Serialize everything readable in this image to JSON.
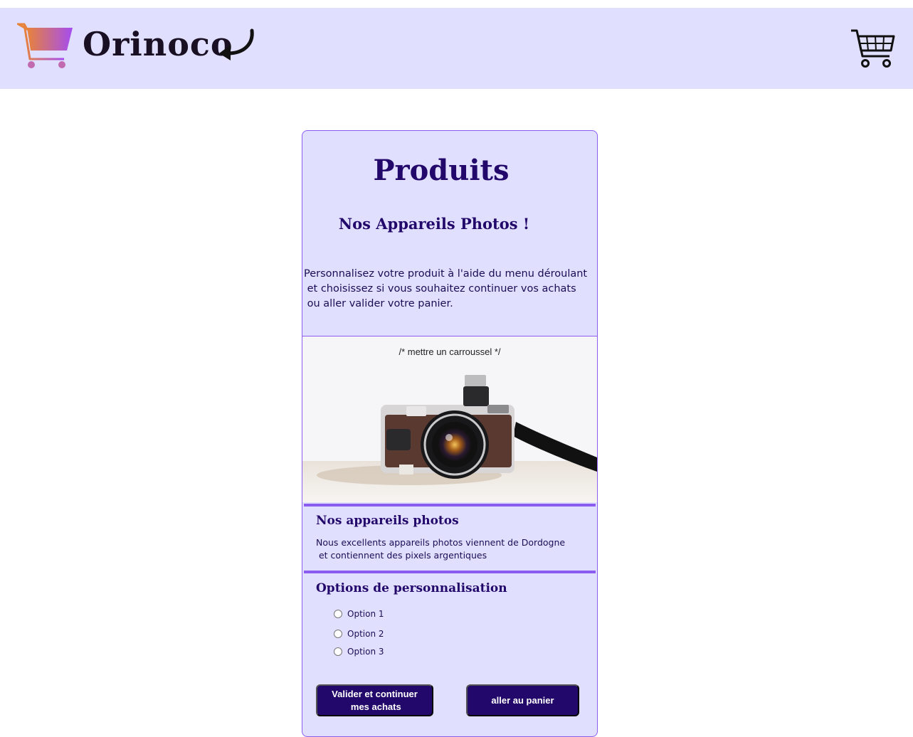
{
  "header": {
    "brand": "Orinoco",
    "logo_icon": "shopping-cart-gradient-icon",
    "back_icon": "curved-back-arrow-icon",
    "cart_icon": "shopping-cart-icon"
  },
  "card": {
    "title": "Produits",
    "subtitle": "Nos Appareils Photos !",
    "intro_lines": [
      "Personnalisez votre produit à l'aide du menu déroulant",
      " et choisissez si vous souhaitez continuer vos achats",
      " ou aller valider votre panier."
    ],
    "carousel_note": "/* mettre un carroussel */",
    "product": {
      "heading": "Nos appareils photos",
      "description_lines": [
        "Nous excellents appareils photos viennent de Dordogne",
        " et contiennent des pixels argentiques"
      ]
    },
    "options": {
      "heading": "Options de personnalisation",
      "items": [
        "Option 1",
        "Option 2",
        "Option 3"
      ]
    },
    "buttons": {
      "validate": "Valider et continuer\n mes achats",
      "cart": "aller au panier"
    }
  },
  "colors": {
    "header_bg": "#e1dffe",
    "accent": "#8a5cf0",
    "dark_purple": "#22086a"
  }
}
